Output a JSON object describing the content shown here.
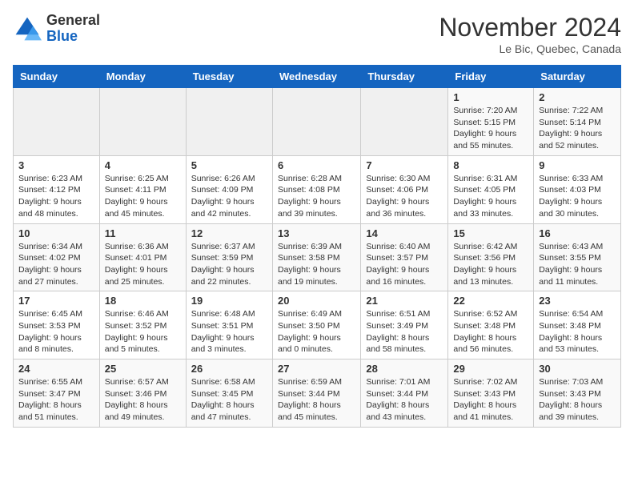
{
  "logo": {
    "general": "General",
    "blue": "Blue"
  },
  "title": "November 2024",
  "location": "Le Bic, Quebec, Canada",
  "headers": [
    "Sunday",
    "Monday",
    "Tuesday",
    "Wednesday",
    "Thursday",
    "Friday",
    "Saturday"
  ],
  "weeks": [
    [
      {
        "day": "",
        "info": ""
      },
      {
        "day": "",
        "info": ""
      },
      {
        "day": "",
        "info": ""
      },
      {
        "day": "",
        "info": ""
      },
      {
        "day": "",
        "info": ""
      },
      {
        "day": "1",
        "info": "Sunrise: 7:20 AM\nSunset: 5:15 PM\nDaylight: 9 hours and 55 minutes."
      },
      {
        "day": "2",
        "info": "Sunrise: 7:22 AM\nSunset: 5:14 PM\nDaylight: 9 hours and 52 minutes."
      }
    ],
    [
      {
        "day": "3",
        "info": "Sunrise: 6:23 AM\nSunset: 4:12 PM\nDaylight: 9 hours and 48 minutes."
      },
      {
        "day": "4",
        "info": "Sunrise: 6:25 AM\nSunset: 4:11 PM\nDaylight: 9 hours and 45 minutes."
      },
      {
        "day": "5",
        "info": "Sunrise: 6:26 AM\nSunset: 4:09 PM\nDaylight: 9 hours and 42 minutes."
      },
      {
        "day": "6",
        "info": "Sunrise: 6:28 AM\nSunset: 4:08 PM\nDaylight: 9 hours and 39 minutes."
      },
      {
        "day": "7",
        "info": "Sunrise: 6:30 AM\nSunset: 4:06 PM\nDaylight: 9 hours and 36 minutes."
      },
      {
        "day": "8",
        "info": "Sunrise: 6:31 AM\nSunset: 4:05 PM\nDaylight: 9 hours and 33 minutes."
      },
      {
        "day": "9",
        "info": "Sunrise: 6:33 AM\nSunset: 4:03 PM\nDaylight: 9 hours and 30 minutes."
      }
    ],
    [
      {
        "day": "10",
        "info": "Sunrise: 6:34 AM\nSunset: 4:02 PM\nDaylight: 9 hours and 27 minutes."
      },
      {
        "day": "11",
        "info": "Sunrise: 6:36 AM\nSunset: 4:01 PM\nDaylight: 9 hours and 25 minutes."
      },
      {
        "day": "12",
        "info": "Sunrise: 6:37 AM\nSunset: 3:59 PM\nDaylight: 9 hours and 22 minutes."
      },
      {
        "day": "13",
        "info": "Sunrise: 6:39 AM\nSunset: 3:58 PM\nDaylight: 9 hours and 19 minutes."
      },
      {
        "day": "14",
        "info": "Sunrise: 6:40 AM\nSunset: 3:57 PM\nDaylight: 9 hours and 16 minutes."
      },
      {
        "day": "15",
        "info": "Sunrise: 6:42 AM\nSunset: 3:56 PM\nDaylight: 9 hours and 13 minutes."
      },
      {
        "day": "16",
        "info": "Sunrise: 6:43 AM\nSunset: 3:55 PM\nDaylight: 9 hours and 11 minutes."
      }
    ],
    [
      {
        "day": "17",
        "info": "Sunrise: 6:45 AM\nSunset: 3:53 PM\nDaylight: 9 hours and 8 minutes."
      },
      {
        "day": "18",
        "info": "Sunrise: 6:46 AM\nSunset: 3:52 PM\nDaylight: 9 hours and 5 minutes."
      },
      {
        "day": "19",
        "info": "Sunrise: 6:48 AM\nSunset: 3:51 PM\nDaylight: 9 hours and 3 minutes."
      },
      {
        "day": "20",
        "info": "Sunrise: 6:49 AM\nSunset: 3:50 PM\nDaylight: 9 hours and 0 minutes."
      },
      {
        "day": "21",
        "info": "Sunrise: 6:51 AM\nSunset: 3:49 PM\nDaylight: 8 hours and 58 minutes."
      },
      {
        "day": "22",
        "info": "Sunrise: 6:52 AM\nSunset: 3:48 PM\nDaylight: 8 hours and 56 minutes."
      },
      {
        "day": "23",
        "info": "Sunrise: 6:54 AM\nSunset: 3:48 PM\nDaylight: 8 hours and 53 minutes."
      }
    ],
    [
      {
        "day": "24",
        "info": "Sunrise: 6:55 AM\nSunset: 3:47 PM\nDaylight: 8 hours and 51 minutes."
      },
      {
        "day": "25",
        "info": "Sunrise: 6:57 AM\nSunset: 3:46 PM\nDaylight: 8 hours and 49 minutes."
      },
      {
        "day": "26",
        "info": "Sunrise: 6:58 AM\nSunset: 3:45 PM\nDaylight: 8 hours and 47 minutes."
      },
      {
        "day": "27",
        "info": "Sunrise: 6:59 AM\nSunset: 3:44 PM\nDaylight: 8 hours and 45 minutes."
      },
      {
        "day": "28",
        "info": "Sunrise: 7:01 AM\nSunset: 3:44 PM\nDaylight: 8 hours and 43 minutes."
      },
      {
        "day": "29",
        "info": "Sunrise: 7:02 AM\nSunset: 3:43 PM\nDaylight: 8 hours and 41 minutes."
      },
      {
        "day": "30",
        "info": "Sunrise: 7:03 AM\nSunset: 3:43 PM\nDaylight: 8 hours and 39 minutes."
      }
    ]
  ]
}
